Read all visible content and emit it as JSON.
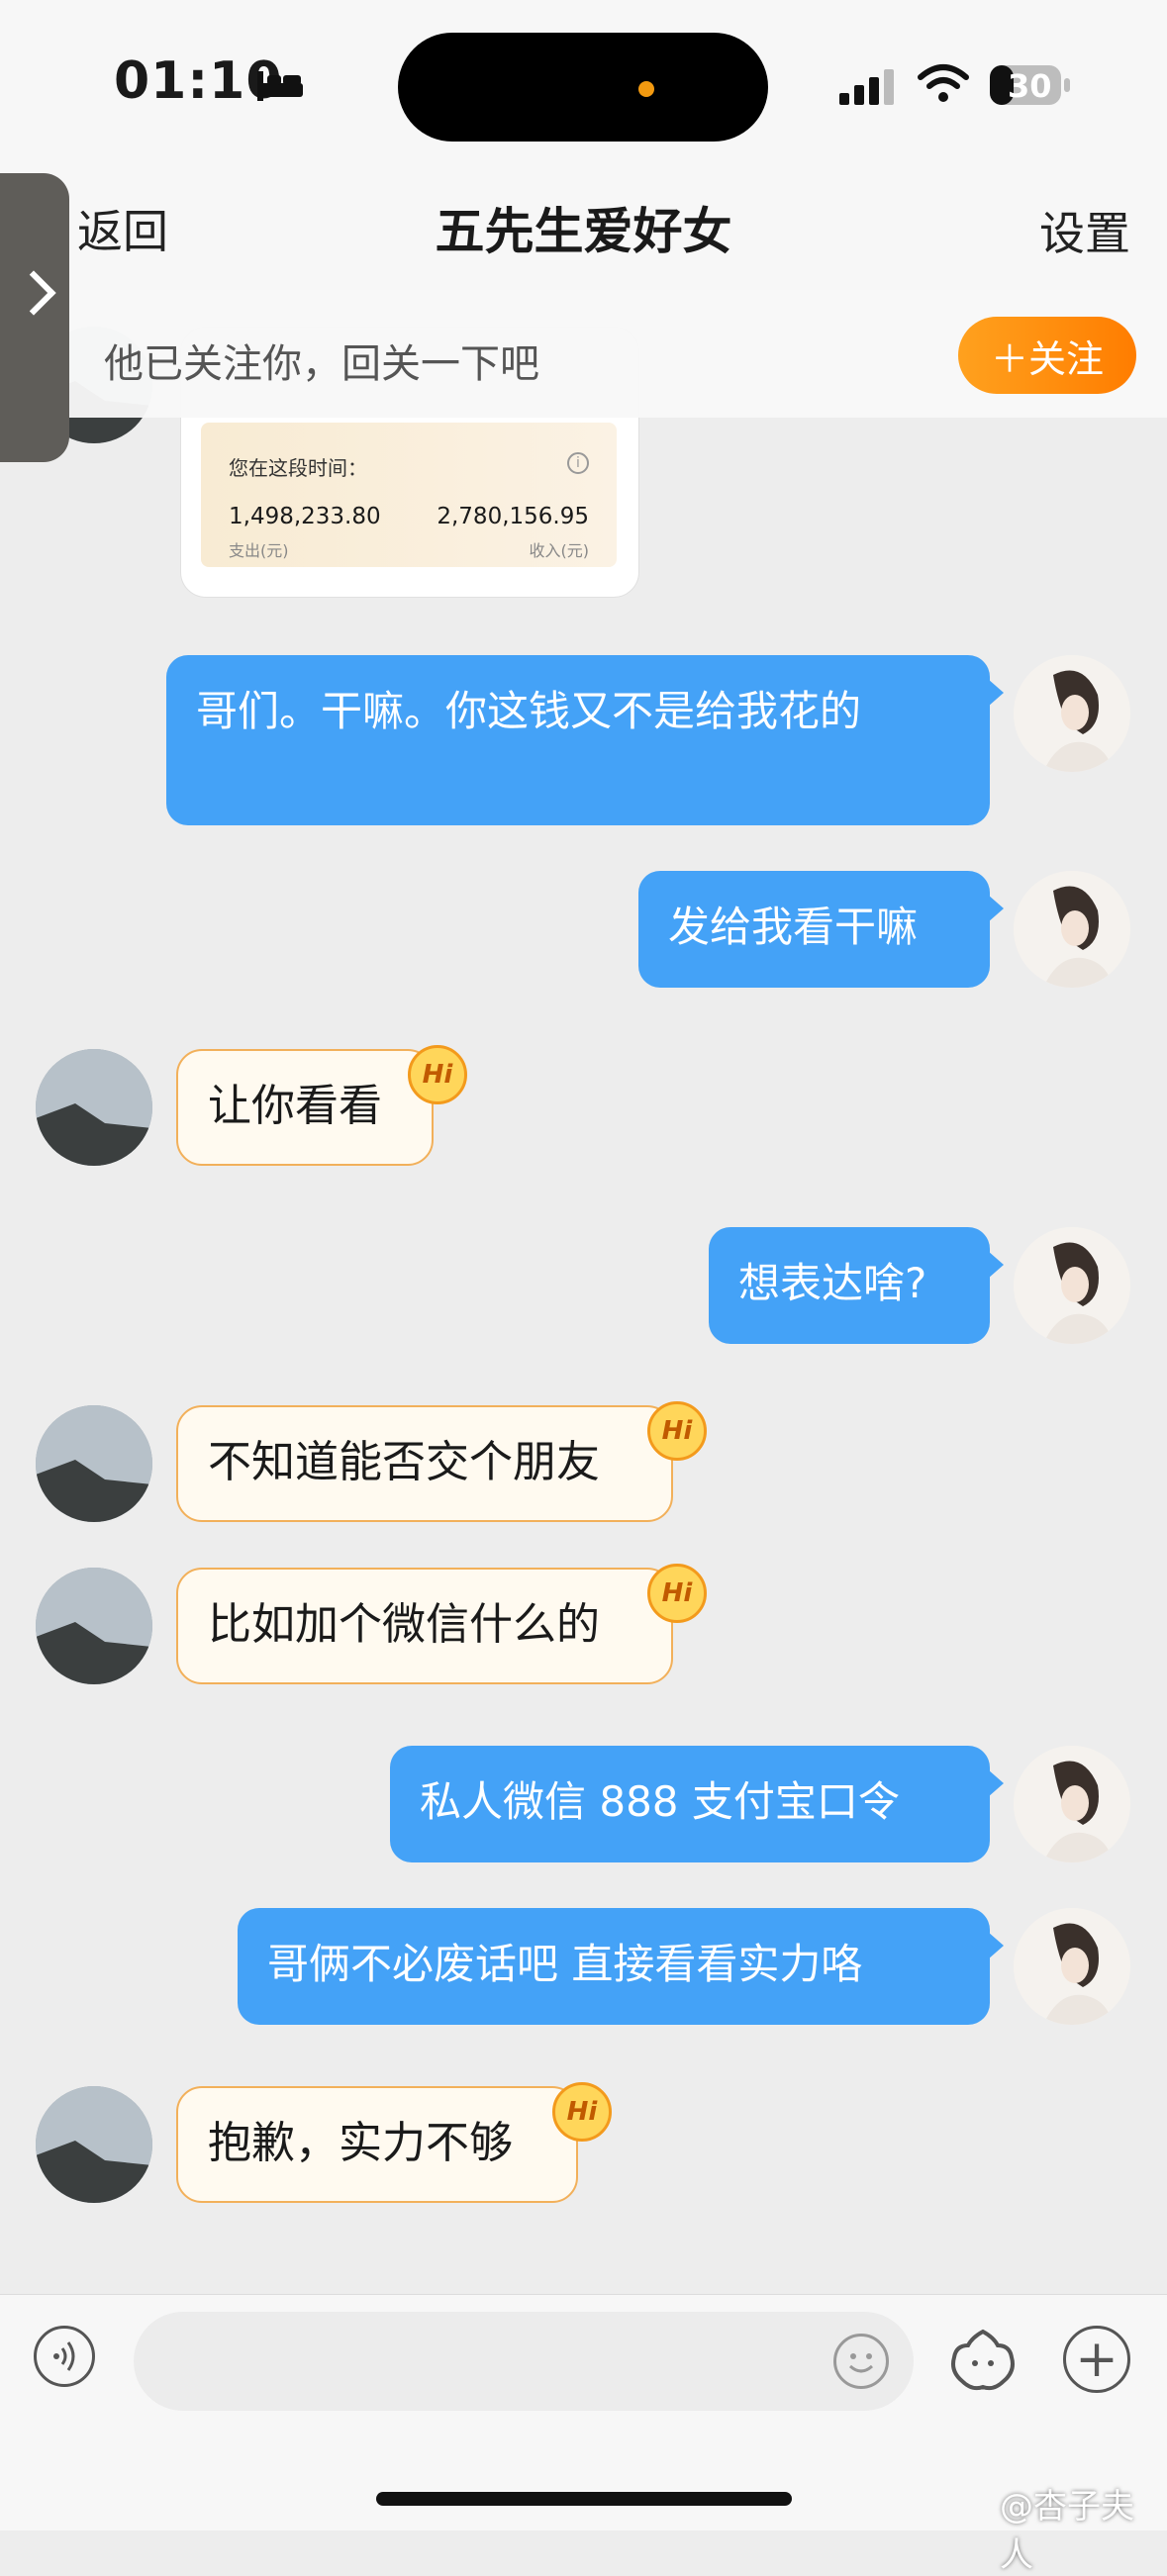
{
  "status_bar": {
    "time": "01:10",
    "battery": "30"
  },
  "nav": {
    "back_label": "返回",
    "title": "五先生爱好女",
    "settings_label": "设置"
  },
  "follow_banner": {
    "text": "他已关注你，回关一下吧",
    "button_label": "＋关注"
  },
  "shared_card": {
    "heading": "您在这段时间：",
    "left_value": "1,498,233.80",
    "left_label": "支出(元)",
    "right_value": "2,780,156.95",
    "right_label": "收入(元)"
  },
  "messages": [
    {
      "side": "right",
      "text": "哥们。干嘛。你这钱又不是给我花的"
    },
    {
      "side": "right",
      "text": "发给我看干嘛"
    },
    {
      "side": "left",
      "text": "让你看看",
      "badge": "Hi"
    },
    {
      "side": "right",
      "text": "想表达啥?"
    },
    {
      "side": "left",
      "text": "不知道能否交个朋友",
      "badge": "Hi"
    },
    {
      "side": "left",
      "text": "比如加个微信什么的",
      "badge": "Hi"
    },
    {
      "side": "right",
      "text": "私人微信 888 支付宝口令"
    },
    {
      "side": "right",
      "text": "哥俩不必废话吧 直接看看实力咯"
    },
    {
      "side": "left",
      "text": "抱歉，实力不够",
      "badge": "Hi"
    }
  ],
  "watermark": "@杏子夫人",
  "colors": {
    "right_bubble": "#44a2f7",
    "left_bubble_border": "#f2b05a",
    "follow_button": "#ff8a0d"
  }
}
